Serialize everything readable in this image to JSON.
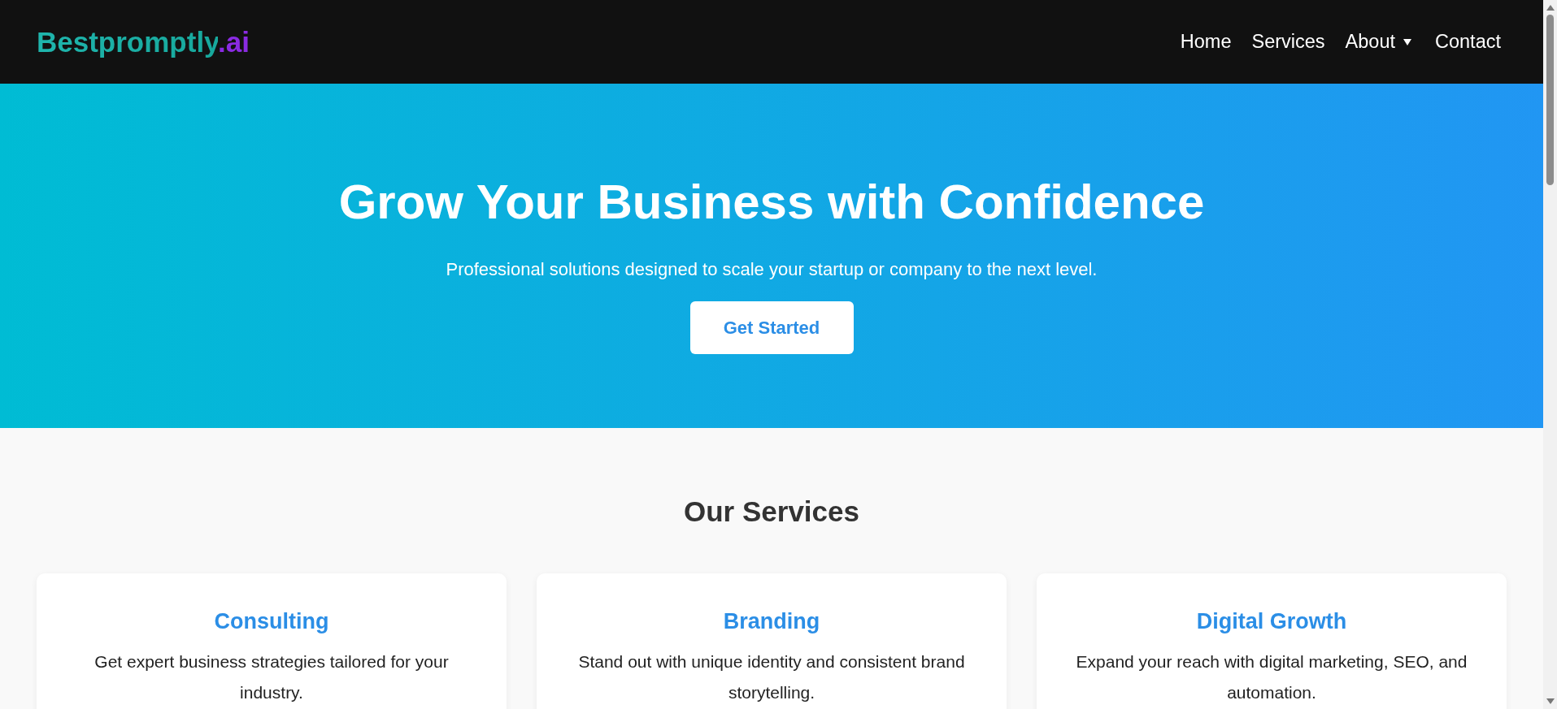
{
  "header": {
    "logo": {
      "name": "Bestpromptly",
      "suffix": ".ai"
    },
    "nav": [
      {
        "label": "Home",
        "has_dropdown": false
      },
      {
        "label": "Services",
        "has_dropdown": false
      },
      {
        "label": "About",
        "has_dropdown": true
      },
      {
        "label": "Contact",
        "has_dropdown": false
      }
    ]
  },
  "hero": {
    "title": "Grow Your Business with Confidence",
    "subtitle": "Professional solutions designed to scale your startup or company to the next level.",
    "button": "Get Started"
  },
  "services": {
    "title": "Our Services",
    "cards": [
      {
        "title": "Consulting",
        "description": "Get expert business strategies tailored for your industry."
      },
      {
        "title": "Branding",
        "description": "Stand out with unique identity and consistent brand storytelling."
      },
      {
        "title": "Digital Growth",
        "description": "Expand your reach with digital marketing, SEO, and automation."
      }
    ]
  }
}
